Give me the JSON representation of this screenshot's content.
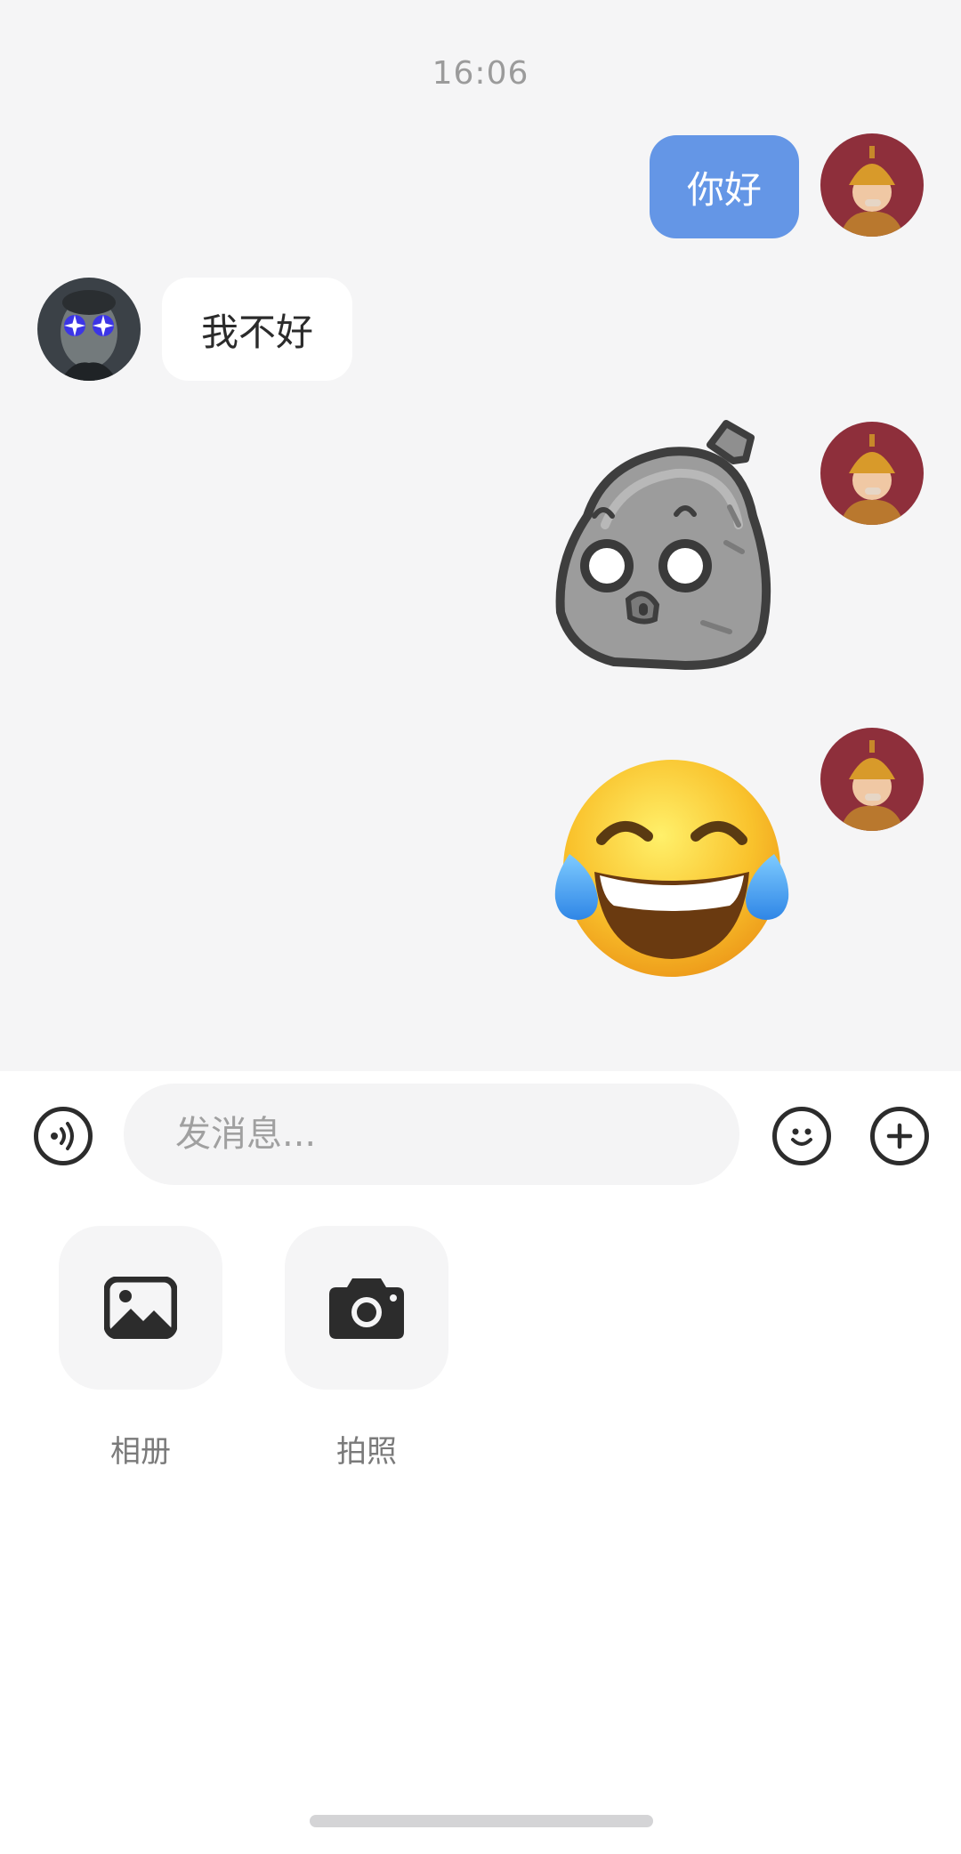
{
  "chat": {
    "timestamp": "16:06",
    "messages": [
      {
        "sender": "me",
        "type": "text",
        "text": "你好"
      },
      {
        "sender": "other",
        "type": "text",
        "text": "我不好"
      },
      {
        "sender": "me",
        "type": "sticker",
        "sticker": "rock-sticker"
      },
      {
        "sender": "me",
        "type": "sticker",
        "sticker": "tears-of-joy-emoji"
      }
    ]
  },
  "input_bar": {
    "placeholder": "发消息...",
    "voice_icon": "voice-icon",
    "emoji_icon": "smiley-icon",
    "more_icon": "plus-icon"
  },
  "tools": [
    {
      "icon": "image-icon",
      "label": "相册"
    },
    {
      "icon": "camera-icon",
      "label": "拍照"
    }
  ],
  "colors": {
    "chat_background": "#f5f5f6",
    "my_bubble": "#6496e6",
    "their_bubble": "#ffffff",
    "icon": "#2c2c2c"
  }
}
